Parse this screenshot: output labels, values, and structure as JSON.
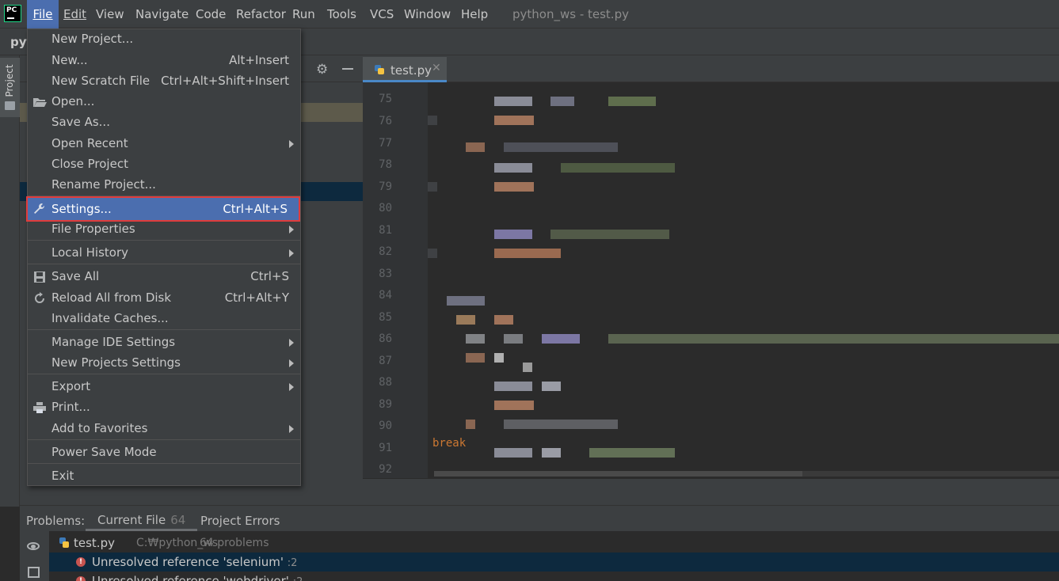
{
  "menubar": {
    "logo": "PC",
    "items": [
      "File",
      "Edit",
      "View",
      "Navigate",
      "Code",
      "Refactor",
      "Run",
      "Tools",
      "VCS",
      "Window",
      "Help"
    ],
    "window_title": "python_ws - test.py"
  },
  "navbar": {
    "project_label": "pyt"
  },
  "left_strip": {
    "project_tab_label": "Project"
  },
  "editor": {
    "tab": {
      "label": "test.py",
      "close": "✕"
    },
    "line_numbers": [
      "75",
      "76",
      "77",
      "78",
      "79",
      "80",
      "81",
      "82",
      "83",
      "84",
      "85",
      "86",
      "87",
      "88",
      "89",
      "90",
      "91",
      "92"
    ],
    "visible_code": "break"
  },
  "file_menu": {
    "new_project": "New Project...",
    "new": "New...",
    "new_shortcut": "Alt+Insert",
    "new_scratch": "New Scratch File",
    "new_scratch_shortcut": "Ctrl+Alt+Shift+Insert",
    "open": "Open...",
    "save_as": "Save As...",
    "open_recent": "Open Recent",
    "close_project": "Close Project",
    "rename_project": "Rename Project...",
    "settings": "Settings...",
    "settings_shortcut": "Ctrl+Alt+S",
    "file_properties": "File Properties",
    "local_history": "Local History",
    "save_all": "Save All",
    "save_all_shortcut": "Ctrl+S",
    "reload": "Reload All from Disk",
    "reload_shortcut": "Ctrl+Alt+Y",
    "invalidate": "Invalidate Caches...",
    "manage_ide": "Manage IDE Settings",
    "new_projects_settings": "New Projects Settings",
    "export": "Export",
    "print": "Print...",
    "add_favorites": "Add to Favorites",
    "power_save": "Power Save Mode",
    "exit": "Exit"
  },
  "problems": {
    "title": "Problems:",
    "tab_current_file": "Current File",
    "tab_current_file_count": "64",
    "tab_project_errors": "Project Errors",
    "file": {
      "name": "test.py",
      "path": "C:₩python_ws",
      "count": "64 problems"
    },
    "rows": [
      {
        "text": "Unresolved reference 'selenium'",
        "line": ":2"
      },
      {
        "text": "Unresolved reference 'webdriver'",
        "line": ":2"
      }
    ]
  },
  "colors": {
    "accent": "#4b6eaf",
    "highlight_border": "#e03c3c",
    "error": "#c75450",
    "panel": "#3c3f41",
    "editor_bg": "#2b2b2b"
  }
}
